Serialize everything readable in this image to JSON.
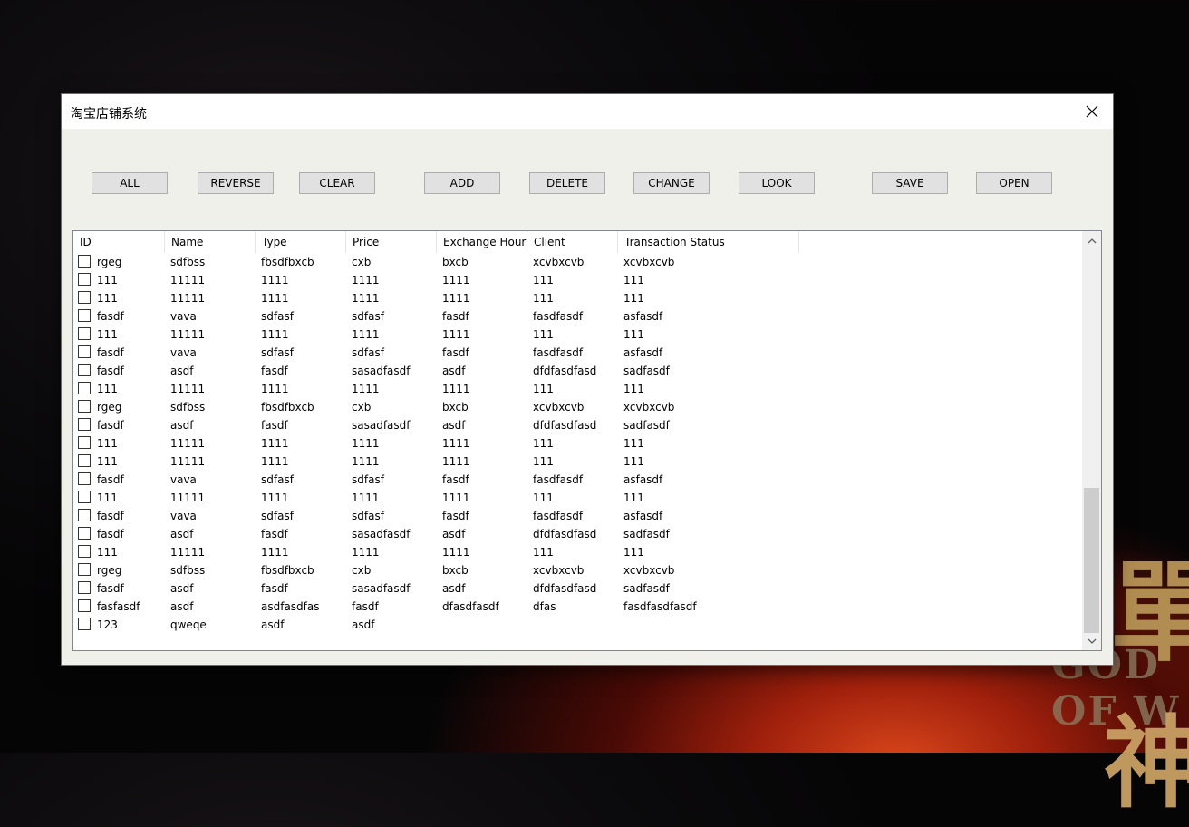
{
  "window": {
    "title": "淘宝店铺系统"
  },
  "background": {
    "glyph_top": "單",
    "glyph_bottom": "神",
    "latin_text": "GOD OF W"
  },
  "toolbar": {
    "all": "ALL",
    "reverse": "REVERSE",
    "clear": "CLEAR",
    "add": "ADD",
    "delete": "DELETE",
    "change": "CHANGE",
    "look": "LOOK",
    "save": "SAVE",
    "open": "OPEN"
  },
  "table": {
    "columns": [
      "ID",
      "Name",
      "Type",
      "Price",
      "Exchange Hour",
      "Client",
      "Transaction Status"
    ],
    "rows": [
      [
        "rgeg",
        "sdfbss",
        "fbsdfbxcb",
        "cxb",
        "bxcb",
        "xcvbxcvb",
        "xcvbxcvb"
      ],
      [
        "111",
        "11111",
        "1111",
        "1111",
        "1111",
        "111",
        "111"
      ],
      [
        "111",
        "11111",
        "1111",
        "1111",
        "1111",
        "111",
        "111"
      ],
      [
        "fasdf",
        "vava",
        "sdfasf",
        "sdfasf",
        "fasdf",
        "fasdfasdf",
        "asfasdf"
      ],
      [
        "111",
        "11111",
        "1111",
        "1111",
        "1111",
        "111",
        "111"
      ],
      [
        "fasdf",
        "vava",
        "sdfasf",
        "sdfasf",
        "fasdf",
        "fasdfasdf",
        "asfasdf"
      ],
      [
        "fasdf",
        "asdf",
        "fasdf",
        "sasadfasdf",
        "asdf",
        "dfdfasdfasd",
        "sadfasdf"
      ],
      [
        "111",
        "11111",
        "1111",
        "1111",
        "1111",
        "111",
        "111"
      ],
      [
        "rgeg",
        "sdfbss",
        "fbsdfbxcb",
        "cxb",
        "bxcb",
        "xcvbxcvb",
        "xcvbxcvb"
      ],
      [
        "fasdf",
        "asdf",
        "fasdf",
        "sasadfasdf",
        "asdf",
        "dfdfasdfasd",
        "sadfasdf"
      ],
      [
        "111",
        "11111",
        "1111",
        "1111",
        "1111",
        "111",
        "111"
      ],
      [
        "111",
        "11111",
        "1111",
        "1111",
        "1111",
        "111",
        "111"
      ],
      [
        "fasdf",
        "vava",
        "sdfasf",
        "sdfasf",
        "fasdf",
        "fasdfasdf",
        "asfasdf"
      ],
      [
        "111",
        "11111",
        "1111",
        "1111",
        "1111",
        "111",
        "111"
      ],
      [
        "fasdf",
        "vava",
        "sdfasf",
        "sdfasf",
        "fasdf",
        "fasdfasdf",
        "asfasdf"
      ],
      [
        "fasdf",
        "asdf",
        "fasdf",
        "sasadfasdf",
        "asdf",
        "dfdfasdfasd",
        "sadfasdf"
      ],
      [
        "111",
        "11111",
        "1111",
        "1111",
        "1111",
        "111",
        "111"
      ],
      [
        "rgeg",
        "sdfbss",
        "fbsdfbxcb",
        "cxb",
        "bxcb",
        "xcvbxcvb",
        "xcvbxcvb"
      ],
      [
        "fasdf",
        "asdf",
        "fasdf",
        "sasadfasdf",
        "asdf",
        "dfdfasdfasd",
        "sadfasdf"
      ],
      [
        "fasfasdf",
        "asdf",
        "asdfasdfas",
        "fasdf",
        "dfasdfasdf",
        "dfas",
        "fasdfasdfasdf"
      ],
      [
        "123",
        "qweqe",
        "asdf",
        "asdf",
        "",
        "",
        ""
      ]
    ]
  },
  "icons": {
    "close": "close-icon",
    "scroll_up": "chevron-up-icon",
    "scroll_down": "chevron-down-icon"
  }
}
